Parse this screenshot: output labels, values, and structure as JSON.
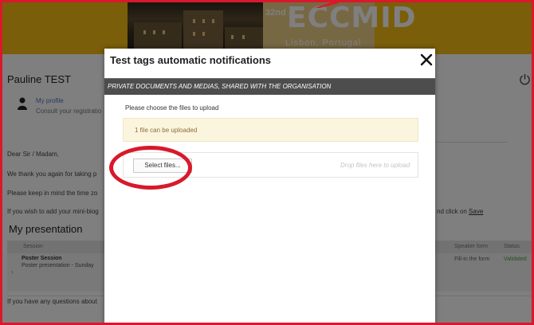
{
  "banner": {
    "edition": "32nd",
    "name": "ECCMID",
    "location": "Lisbon, Portugal"
  },
  "background": {
    "user_name": "Pauline TEST",
    "power_icon": "power-icon",
    "profile": {
      "link": "My profile",
      "subtitle": "Consult your registratio"
    },
    "greeting": "Dear Sir / Madam,",
    "line_thanks": "We thank you again for taking p",
    "line_timezone": "Please keep in mind the time zo",
    "line_bio": "If you wish to add your mini-biog",
    "line_save_tail": "nd click on ",
    "save_link": "Save",
    "presentation_title": "My presentation",
    "table": {
      "headers": {
        "session": "Session",
        "speaker_form": "Speaker form",
        "status": "Status"
      },
      "row": {
        "session_name": "Poster Session",
        "session_sub": "Poster presentation - Sunday",
        "speaker_form": "Fill-in the form",
        "status": "Validated"
      }
    },
    "questions": "If you have any questions about"
  },
  "modal": {
    "title": "Test tags automatic notifications",
    "close_icon": "close-icon",
    "section_label": "Private documents and medias, shared with the organisation",
    "choose_label": "Please choose the files to upload",
    "info": "1 file can be uploaded",
    "select_button": "Select files...",
    "drop_hint": "Drop files here to upload"
  },
  "colors": {
    "banner": "#f5bd12",
    "annotation_red": "#d8192b",
    "section_bar": "#4d4d4d",
    "validated_green": "#4aa843",
    "info_bg": "#fcf5de"
  }
}
